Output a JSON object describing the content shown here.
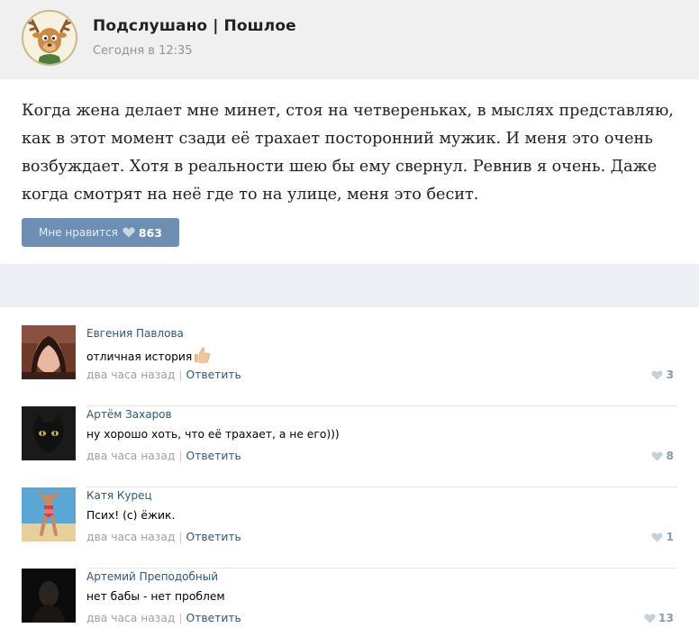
{
  "group": {
    "name": "Подслушано | Пошлое",
    "time": "Сегодня в 12:35"
  },
  "post": {
    "text": "Когда жена делает мне минет, стоя на четвереньках, в мыслях представляю, как в этот момент сзади её трахает посторонний мужик. И меня это очень возбуждает. Хотя в реальности шею бы ему свернул. Ревнив я очень. Даже когда смотрят на неё где то на улице, меня это бесит.",
    "like_label": "Мне нравится",
    "like_count": "863"
  },
  "comments": [
    {
      "author": "Евгения Павлова",
      "text": "отличная история",
      "time": "два часа назад",
      "sep": "|",
      "reply": "Ответить",
      "likes": "3"
    },
    {
      "author": "Артём Захаров",
      "text": "ну хорошо хоть, что её трахает, а не его)))",
      "time": "два часа назад",
      "sep": "|",
      "reply": "Ответить",
      "likes": "8"
    },
    {
      "author": "Катя Курец",
      "text": "Псих! (с) ёжик.",
      "time": "два часа назад",
      "sep": "|",
      "reply": "Ответить",
      "likes": "1"
    },
    {
      "author": "Артемий Преподобный",
      "text": "нет бабы - нет проблем",
      "time": "два часа назад",
      "sep": "|",
      "reply": "Ответить",
      "likes": "13"
    }
  ],
  "colors": {
    "like_button": "#6d8fb3",
    "link": "#2b587a",
    "muted": "#a0a0a0",
    "header_bg": "#f0f0f0",
    "separator_bg": "#eceff3"
  }
}
